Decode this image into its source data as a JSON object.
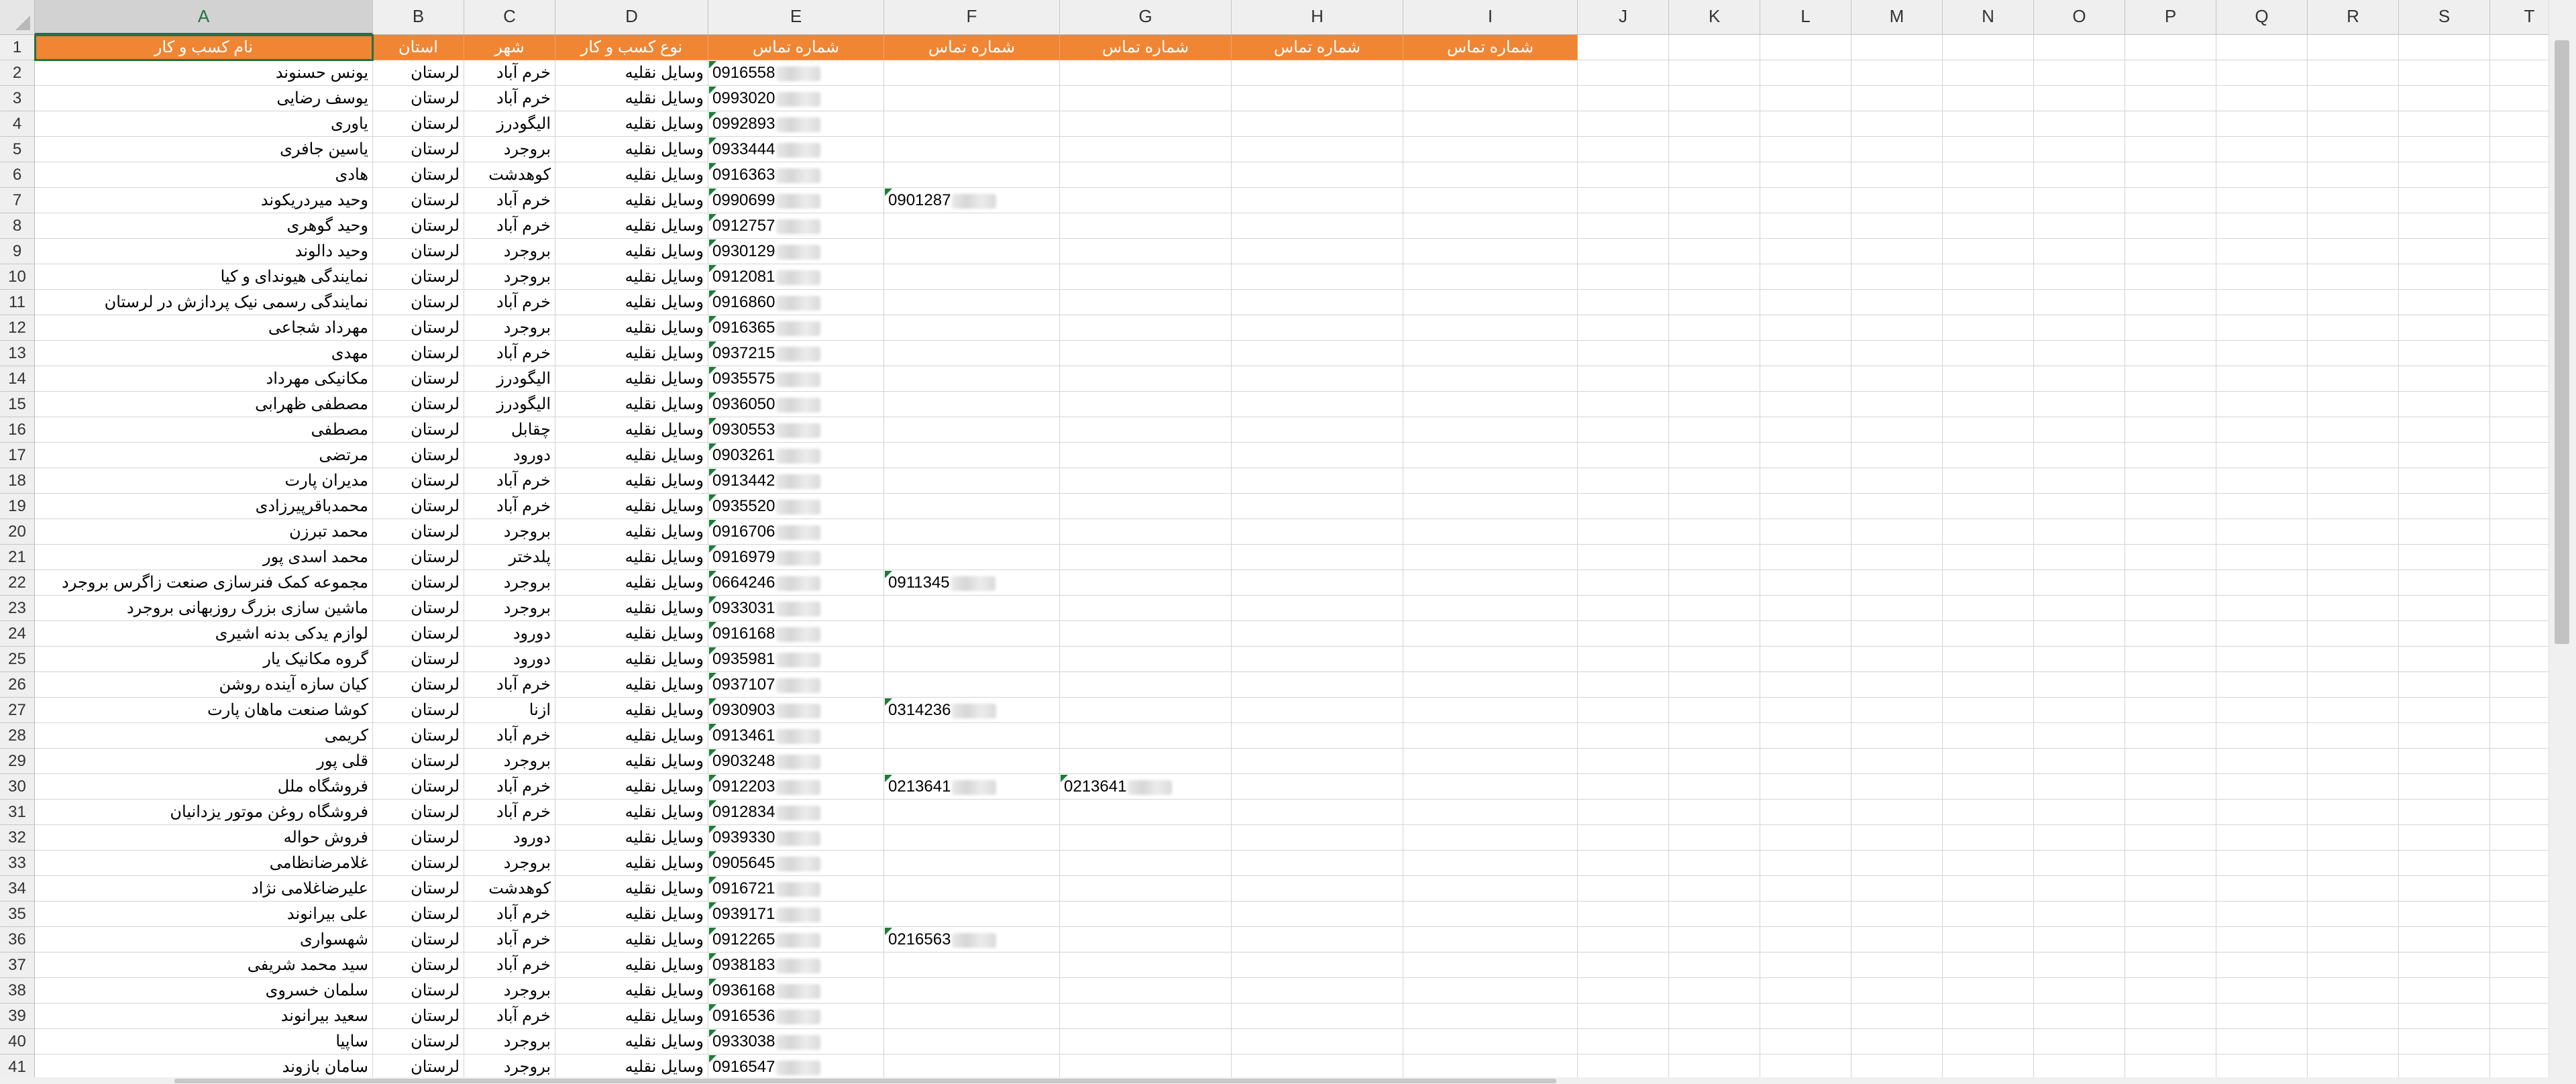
{
  "columns": [
    "A",
    "B",
    "C",
    "D",
    "E",
    "F",
    "G",
    "H",
    "I",
    "J",
    "K",
    "L",
    "M",
    "N",
    "O",
    "P",
    "Q",
    "R",
    "S",
    "T"
  ],
  "selected_column": "A",
  "headers": [
    "نام کسب و کار",
    "استان",
    "شهر",
    "نوع کسب و کار",
    "شماره تماس",
    "شماره تماس",
    "شماره تماس",
    "شماره تماس",
    "شماره تماس"
  ],
  "header_color": "#f08533",
  "rows": [
    {
      "num": "2",
      "name": "یونس حسنوند",
      "prov": "لرستان",
      "city": "خرم آباد",
      "type": "وسایل نقلیه",
      "e": "0916558",
      "f": "",
      "g": ""
    },
    {
      "num": "3",
      "name": "یوسف رضایی",
      "prov": "لرستان",
      "city": "خرم آباد",
      "type": "وسایل نقلیه",
      "e": "0993020",
      "f": "",
      "g": ""
    },
    {
      "num": "4",
      "name": "یاوری",
      "prov": "لرستان",
      "city": "الیگودرز",
      "type": "وسایل نقلیه",
      "e": "0992893",
      "f": "",
      "g": ""
    },
    {
      "num": "5",
      "name": "یاسین جافری",
      "prov": "لرستان",
      "city": "بروجرد",
      "type": "وسایل نقلیه",
      "e": "0933444",
      "f": "",
      "g": ""
    },
    {
      "num": "6",
      "name": "هادی",
      "prov": "لرستان",
      "city": "کوهدشت",
      "type": "وسایل نقلیه",
      "e": "0916363",
      "f": "",
      "g": ""
    },
    {
      "num": "7",
      "name": "وحید میردریکوند",
      "prov": "لرستان",
      "city": "خرم آباد",
      "type": "وسایل نقلیه",
      "e": "0990699",
      "f": "0901287",
      "g": ""
    },
    {
      "num": "8",
      "name": "وحید گوهری",
      "prov": "لرستان",
      "city": "خرم آباد",
      "type": "وسایل نقلیه",
      "e": "0912757",
      "f": "",
      "g": ""
    },
    {
      "num": "9",
      "name": "وحید دالوند",
      "prov": "لرستان",
      "city": "بروجرد",
      "type": "وسایل نقلیه",
      "e": "0930129",
      "f": "",
      "g": ""
    },
    {
      "num": "10",
      "name": "نمایندگی هیوندای و کیا",
      "prov": "لرستان",
      "city": "بروجرد",
      "type": "وسایل نقلیه",
      "e": "0912081",
      "f": "",
      "g": ""
    },
    {
      "num": "11",
      "name": "نمایندگی رسمی نیک پردازش در لرستان",
      "prov": "لرستان",
      "city": "خرم آباد",
      "type": "وسایل نقلیه",
      "e": "0916860",
      "f": "",
      "g": ""
    },
    {
      "num": "12",
      "name": "مهرداد شجاعی",
      "prov": "لرستان",
      "city": "بروجرد",
      "type": "وسایل نقلیه",
      "e": "0916365",
      "f": "",
      "g": ""
    },
    {
      "num": "13",
      "name": "مهدی",
      "prov": "لرستان",
      "city": "خرم آباد",
      "type": "وسایل نقلیه",
      "e": "0937215",
      "f": "",
      "g": ""
    },
    {
      "num": "14",
      "name": "مکانیکی مهرداد",
      "prov": "لرستان",
      "city": "الیگودرز",
      "type": "وسایل نقلیه",
      "e": "0935575",
      "f": "",
      "g": ""
    },
    {
      "num": "15",
      "name": "مصطفی ظهرابی",
      "prov": "لرستان",
      "city": "الیگودرز",
      "type": "وسایل نقلیه",
      "e": "0936050",
      "f": "",
      "g": ""
    },
    {
      "num": "16",
      "name": "مصطفی",
      "prov": "لرستان",
      "city": "چقابل",
      "type": "وسایل نقلیه",
      "e": "0930553",
      "f": "",
      "g": ""
    },
    {
      "num": "17",
      "name": "مرتضی",
      "prov": "لرستان",
      "city": "دورود",
      "type": "وسایل نقلیه",
      "e": "0903261",
      "f": "",
      "g": ""
    },
    {
      "num": "18",
      "name": "مدیران پارت",
      "prov": "لرستان",
      "city": "خرم آباد",
      "type": "وسایل نقلیه",
      "e": "0913442",
      "f": "",
      "g": ""
    },
    {
      "num": "19",
      "name": "محمدباقرپیرزادی",
      "prov": "لرستان",
      "city": "خرم آباد",
      "type": "وسایل نقلیه",
      "e": "0935520",
      "f": "",
      "g": ""
    },
    {
      "num": "20",
      "name": "محمد تبرزن",
      "prov": "لرستان",
      "city": "بروجرد",
      "type": "وسایل نقلیه",
      "e": "0916706",
      "f": "",
      "g": ""
    },
    {
      "num": "21",
      "name": "محمد اسدی پور",
      "prov": "لرستان",
      "city": "پلدختر",
      "type": "وسایل نقلیه",
      "e": "0916979",
      "f": "",
      "g": ""
    },
    {
      "num": "22",
      "name": "مجموعه کمک فنرسازی صنعت زاگرس بروجرد",
      "prov": "لرستان",
      "city": "بروجرد",
      "type": "وسایل نقلیه",
      "e": "0664246",
      "f": "0911345",
      "g": ""
    },
    {
      "num": "23",
      "name": "ماشین سازی بزرگ روزبهانی بروجرد",
      "prov": "لرستان",
      "city": "بروجرد",
      "type": "وسایل نقلیه",
      "e": "0933031",
      "f": "",
      "g": ""
    },
    {
      "num": "24",
      "name": "لوازم یدکی بدنه اشیری",
      "prov": "لرستان",
      "city": "دورود",
      "type": "وسایل نقلیه",
      "e": "0916168",
      "f": "",
      "g": ""
    },
    {
      "num": "25",
      "name": "گروه مکانیک یار",
      "prov": "لرستان",
      "city": "دورود",
      "type": "وسایل نقلیه",
      "e": "0935981",
      "f": "",
      "g": ""
    },
    {
      "num": "26",
      "name": "کیان سازه آینده روشن",
      "prov": "لرستان",
      "city": "خرم آباد",
      "type": "وسایل نقلیه",
      "e": "0937107",
      "f": "",
      "g": ""
    },
    {
      "num": "27",
      "name": "کوشا صنعت ماهان پارت",
      "prov": "لرستان",
      "city": "ازنا",
      "type": "وسایل نقلیه",
      "e": "0930903",
      "f": "0314236",
      "g": ""
    },
    {
      "num": "28",
      "name": "کریمی",
      "prov": "لرستان",
      "city": "خرم آباد",
      "type": "وسایل نقلیه",
      "e": "0913461",
      "f": "",
      "g": ""
    },
    {
      "num": "29",
      "name": "قلی پور",
      "prov": "لرستان",
      "city": "بروجرد",
      "type": "وسایل نقلیه",
      "e": "0903248",
      "f": "",
      "g": ""
    },
    {
      "num": "30",
      "name": "فروشگاه ملل",
      "prov": "لرستان",
      "city": "خرم آباد",
      "type": "وسایل نقلیه",
      "e": "0912203",
      "f": "0213641",
      "g": "0213641"
    },
    {
      "num": "31",
      "name": "فروشگاه روغن موتور یزدانیان",
      "prov": "لرستان",
      "city": "خرم آباد",
      "type": "وسایل نقلیه",
      "e": "0912834",
      "f": "",
      "g": ""
    },
    {
      "num": "32",
      "name": "فروش حواله",
      "prov": "لرستان",
      "city": "دورود",
      "type": "وسایل نقلیه",
      "e": "0939330",
      "f": "",
      "g": ""
    },
    {
      "num": "33",
      "name": "غلامرضانظامی",
      "prov": "لرستان",
      "city": "بروجرد",
      "type": "وسایل نقلیه",
      "e": "0905645",
      "f": "",
      "g": ""
    },
    {
      "num": "34",
      "name": "علیرضاغلامی نژاد",
      "prov": "لرستان",
      "city": "کوهدشت",
      "type": "وسایل نقلیه",
      "e": "0916721",
      "f": "",
      "g": ""
    },
    {
      "num": "35",
      "name": "علی بیرانوند",
      "prov": "لرستان",
      "city": "خرم آباد",
      "type": "وسایل نقلیه",
      "e": "0939171",
      "f": "",
      "g": ""
    },
    {
      "num": "36",
      "name": "شهسواری",
      "prov": "لرستان",
      "city": "خرم آباد",
      "type": "وسایل نقلیه",
      "e": "0912265",
      "f": "0216563",
      "g": ""
    },
    {
      "num": "37",
      "name": "سید محمد شریفی",
      "prov": "لرستان",
      "city": "خرم آباد",
      "type": "وسایل نقلیه",
      "e": "0938183",
      "f": "",
      "g": ""
    },
    {
      "num": "38",
      "name": "سلمان خسروی",
      "prov": "لرستان",
      "city": "بروجرد",
      "type": "وسایل نقلیه",
      "e": "0936168",
      "f": "",
      "g": ""
    },
    {
      "num": "39",
      "name": "سعید بیرانوند",
      "prov": "لرستان",
      "city": "خرم آباد",
      "type": "وسایل نقلیه",
      "e": "0916536",
      "f": "",
      "g": ""
    },
    {
      "num": "40",
      "name": "ساپیا",
      "prov": "لرستان",
      "city": "بروجرد",
      "type": "وسایل نقلیه",
      "e": "0933038",
      "f": "",
      "g": ""
    },
    {
      "num": "41",
      "name": "سامان بازوند",
      "prov": "لرستان",
      "city": "بروجرد",
      "type": "وسایل نقلیه",
      "e": "0916547",
      "f": "",
      "g": ""
    }
  ]
}
